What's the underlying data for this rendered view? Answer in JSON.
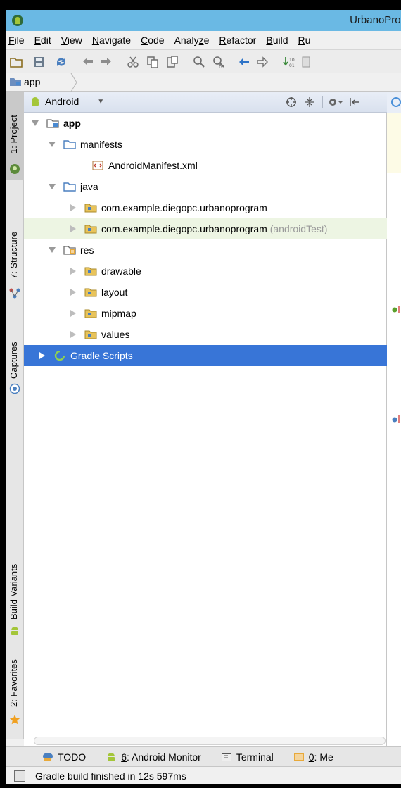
{
  "window": {
    "title": "UrbanoProg"
  },
  "menu": [
    {
      "u": "F",
      "rest": "ile"
    },
    {
      "u": "E",
      "rest": "dit"
    },
    {
      "u": "V",
      "rest": "iew"
    },
    {
      "u": "N",
      "rest": "avigate"
    },
    {
      "u": "C",
      "rest": "ode"
    },
    {
      "pre": "Analy",
      "u": "z",
      "rest": "e"
    },
    {
      "u": "R",
      "rest": "efactor"
    },
    {
      "u": "B",
      "rest": "uild"
    },
    {
      "u": "R",
      "rest": "u"
    }
  ],
  "breadcrumb": {
    "label": "app"
  },
  "left_tabs": {
    "project": "1: Project",
    "structure": "7: Structure",
    "captures": "Captures",
    "build_variants": "Build Variants",
    "favorites": "2: Favorites"
  },
  "project_panel": {
    "view_mode": "Android",
    "tree": [
      {
        "label": "app",
        "bold": true
      },
      {
        "label": "manifests"
      },
      {
        "label": "AndroidManifest.xml"
      },
      {
        "label": "java"
      },
      {
        "label": "com.example.diegopc.urbanoprogram"
      },
      {
        "label": "com.example.diegopc.urbanoprogram",
        "hint": "(androidTest)"
      },
      {
        "label": "res"
      },
      {
        "label": "drawable"
      },
      {
        "label": "layout"
      },
      {
        "label": "mipmap"
      },
      {
        "label": "values"
      },
      {
        "label": "Gradle Scripts"
      }
    ]
  },
  "bottom_tabs": {
    "todo": "TODO",
    "android_monitor_u": "6",
    "android_monitor_rest": ": Android Monitor",
    "terminal": "Terminal",
    "messages_u": "0",
    "messages_rest": ": Me"
  },
  "status": {
    "message": "Gradle build finished in 12s 597ms"
  },
  "colors": {
    "titlebar": "#6ab9e4",
    "selection": "#3875d7",
    "row_highlight": "#edf5e3"
  }
}
